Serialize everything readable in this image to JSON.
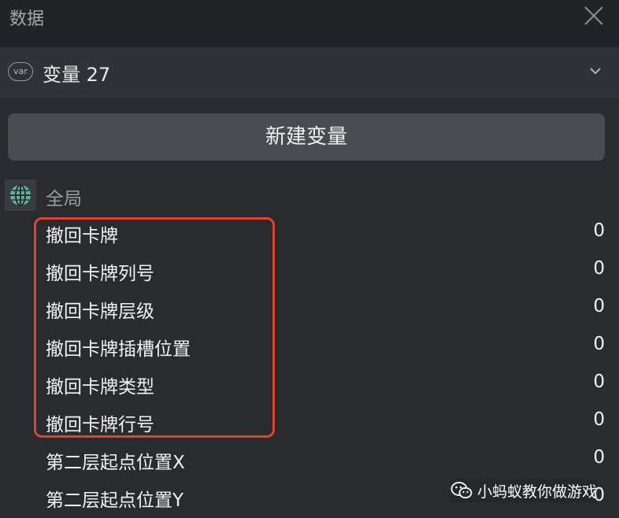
{
  "panel": {
    "title": "数据",
    "close_icon": "close-icon"
  },
  "variable_selector": {
    "badge": "var",
    "label": "变量 27",
    "chevron_icon": "chevron-down-icon"
  },
  "new_variable_button": "新建变量",
  "scope": {
    "icon": "globe-icon",
    "label": "全局"
  },
  "variables": [
    {
      "name": "撤回卡牌",
      "value": "0"
    },
    {
      "name": "撤回卡牌列号",
      "value": "0"
    },
    {
      "name": "撤回卡牌层级",
      "value": "0"
    },
    {
      "name": "撤回卡牌插槽位置",
      "value": "0"
    },
    {
      "name": "撤回卡牌类型",
      "value": "0"
    },
    {
      "name": "撤回卡牌行号",
      "value": "0"
    },
    {
      "name": "第二层起点位置X",
      "value": "0"
    },
    {
      "name": "第二层起点位置Y",
      "value": "0"
    }
  ],
  "annotation": {
    "highlight_color": "#e0442f"
  },
  "watermark": {
    "icon": "wechat-icon",
    "text": "小蚂蚁教你做游戏"
  },
  "colors": {
    "background": "#2a2b2f",
    "titlebar": "#222327",
    "button": "#4a4b50",
    "globe": "#5fb89a"
  }
}
